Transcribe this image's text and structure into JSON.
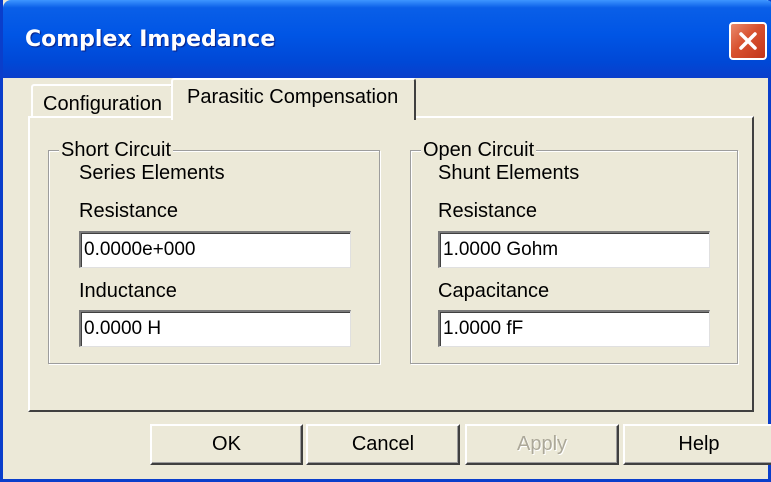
{
  "window": {
    "title": "Complex Impedance"
  },
  "tabs": [
    {
      "label": "Configuration",
      "active": false
    },
    {
      "label": "Parasitic Compensation",
      "active": true
    }
  ],
  "short_circuit": {
    "legend": "Short Circuit",
    "subtitle": "Series Elements",
    "resistance_label": "Resistance",
    "resistance_value": "0.0000e+000",
    "inductance_label": "Inductance",
    "inductance_value": "0.0000 H"
  },
  "open_circuit": {
    "legend": "Open Circuit",
    "subtitle": "Shunt Elements",
    "resistance_label": "Resistance",
    "resistance_value": "1.0000 Gohm",
    "capacitance_label": "Capacitance",
    "capacitance_value": "1.0000 fF"
  },
  "buttons": {
    "ok": "OK",
    "cancel": "Cancel",
    "apply": "Apply",
    "help": "Help"
  },
  "icons": {
    "close": "close-icon"
  },
  "colors": {
    "titlebar": "#0055e5",
    "close_button": "#d8512f",
    "dialog_background": "#ece9d8",
    "disabled_text": "#aca899"
  }
}
